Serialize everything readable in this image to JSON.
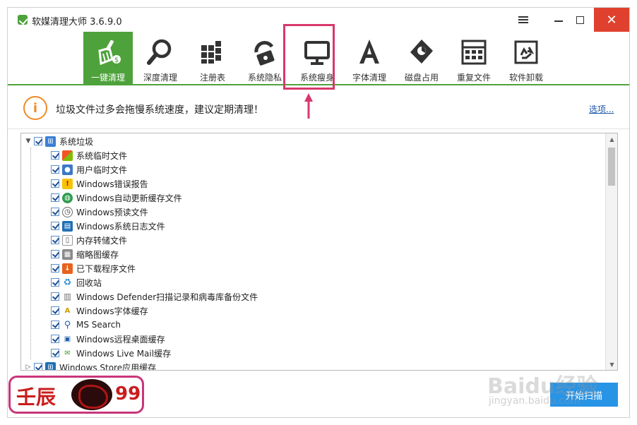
{
  "window": {
    "title": "软媒清理大师 3.6.9.0",
    "close_glyph": "✕"
  },
  "toolbar": {
    "items": [
      {
        "label": "一键清理",
        "active": true
      },
      {
        "label": "深度清理",
        "active": false
      },
      {
        "label": "注册表",
        "active": false
      },
      {
        "label": "系统隐私",
        "active": false
      },
      {
        "label": "系统瘦身",
        "active": false
      },
      {
        "label": "字体清理",
        "active": false
      },
      {
        "label": "磁盘占用",
        "active": false
      },
      {
        "label": "重复文件",
        "active": false
      },
      {
        "label": "软件卸载",
        "active": false
      }
    ]
  },
  "infobar": {
    "icon_glyph": "i",
    "message": "垃圾文件过多会拖慢系统速度，建议定期清理！",
    "options_link": "选项..."
  },
  "tree": {
    "root": {
      "label": "系统垃圾"
    },
    "children": [
      {
        "label": "系统临时文件",
        "icon": "windows-flag-icon"
      },
      {
        "label": "用户临时文件",
        "icon": "user-icon"
      },
      {
        "label": "Windows错误报告",
        "icon": "warning-icon"
      },
      {
        "label": "Windows自动更新缓存文件",
        "icon": "globe-icon"
      },
      {
        "label": "Windows预读文件",
        "icon": "clock-icon"
      },
      {
        "label": "Windows系统日志文件",
        "icon": "log-icon"
      },
      {
        "label": "内存转储文件",
        "icon": "file-icon"
      },
      {
        "label": "缩略图缓存",
        "icon": "thumbnail-icon"
      },
      {
        "label": "已下载程序文件",
        "icon": "download-icon"
      },
      {
        "label": "回收站",
        "icon": "recycle-icon"
      },
      {
        "label": "Windows Defender扫描记录和病毒库备份文件",
        "icon": "defender-icon"
      },
      {
        "label": "Windows字体缓存",
        "icon": "font-icon"
      },
      {
        "label": "MS Search",
        "icon": "search-icon"
      },
      {
        "label": "Windows远程桌面缓存",
        "icon": "remote-desktop-icon"
      },
      {
        "label": "Windows Live Mail缓存",
        "icon": "mail-icon"
      }
    ],
    "second_root": {
      "label": "Windows Store应用缓存"
    }
  },
  "bottom": {
    "start_button": "开始扫描"
  },
  "watermark": {
    "left_text": "壬辰",
    "number": "99",
    "baidu": "Baidu经验",
    "url": "jingyan.baidu.com"
  },
  "colors": {
    "accent_green": "#4ea23b",
    "highlight": "#d8386b",
    "close_red": "#e0412e",
    "button_blue": "#2894e6",
    "info_orange": "#f08a24"
  }
}
